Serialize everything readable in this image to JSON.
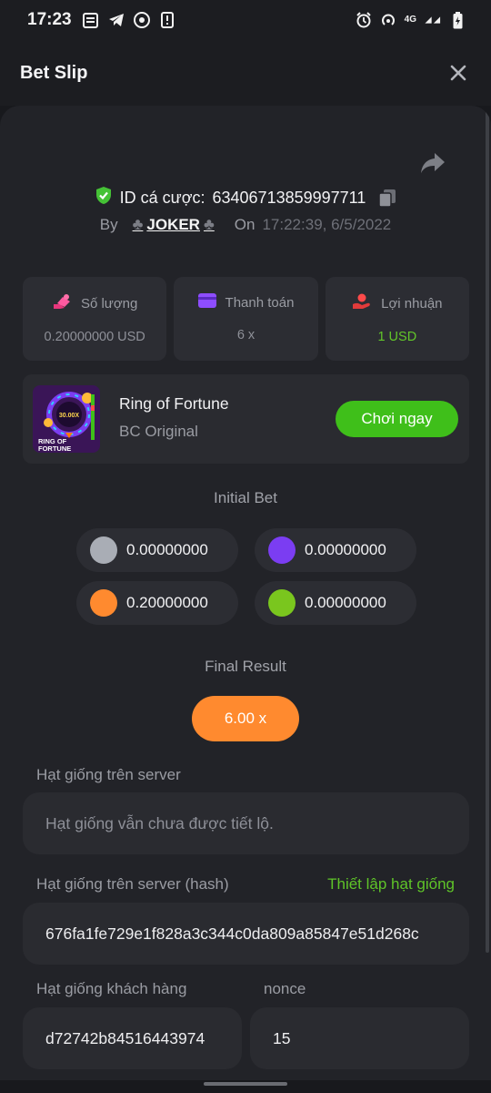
{
  "status_bar": {
    "time": "17:23",
    "network": "4G",
    "icons_left": [
      "news-icon",
      "telegram-icon",
      "chrome-icon",
      "notification-icon"
    ],
    "icons_right": [
      "alarm-icon",
      "hotspot-icon",
      "signal-icon",
      "battery-icon"
    ]
  },
  "header": {
    "title": "Bet Slip",
    "close_icon": "close-icon"
  },
  "bet": {
    "id_label": "ID cá cược:",
    "id_value": "63406713859997711",
    "by_label": "By",
    "player": "JOKER",
    "on_label": "On",
    "time": "17:22:39, 6/5/2022"
  },
  "stats": [
    {
      "label": "Số lượng",
      "value": "0.20000000 USD",
      "icon": "wager-icon"
    },
    {
      "label": "Thanh toán",
      "value": "6 x",
      "icon": "payout-card-icon"
    },
    {
      "label": "Lợi nhuận",
      "value": "1 USD",
      "icon": "profit-hand-icon"
    }
  ],
  "game": {
    "name": "Ring of Fortune",
    "provider": "BC Original",
    "thumb_text_top": "30.00X",
    "thumb_text_1": "RING OF",
    "thumb_text_2": "FORTUNE",
    "play_label": "Chơi ngay"
  },
  "initial_bet": {
    "title": "Initial Bet",
    "chips": [
      {
        "color": "#a9adb5",
        "value": "0.00000000"
      },
      {
        "color": "#7b3df2",
        "value": "0.00000000"
      },
      {
        "color": "#ff8a2f",
        "value": "0.20000000"
      },
      {
        "color": "#7ac61e",
        "value": "0.00000000"
      }
    ]
  },
  "final_result": {
    "title": "Final Result",
    "value": "6.00 x"
  },
  "fairness": {
    "server_seed_label": "Hạt giống trên server",
    "server_seed_value": "Hạt giống vẫn chưa được tiết lộ.",
    "server_hash_label": "Hạt giống trên server (hash)",
    "set_seed_link": "Thiết lập hạt giống",
    "server_hash_value": "676fa1fe729e1f828a3c344c0da809a85847e51d268c",
    "client_seed_label": "Hạt giống khách hàng",
    "client_seed_value": "d72742b84516443974",
    "nonce_label": "nonce",
    "nonce_value": "15"
  },
  "colors": {
    "accent_green": "#3fbf1a",
    "accent_orange": "#ff8a2f",
    "background": "#222328"
  }
}
